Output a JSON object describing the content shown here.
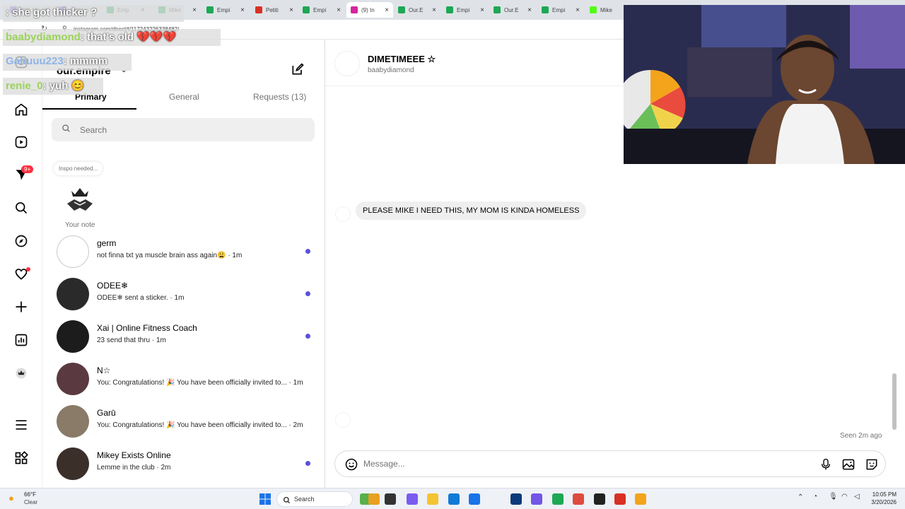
{
  "browser": {
    "tabs": [
      {
        "label": "(20) M",
        "color": "#7b5cd6"
      },
      {
        "label": "(20) L",
        "color": "#7b5cd6"
      },
      {
        "label": "Emp",
        "color": "#1ea853"
      },
      {
        "label": "Mike",
        "color": "#1ea853"
      },
      {
        "label": "Empi",
        "color": "#1ea853"
      },
      {
        "label": "Petiti",
        "color": "#d93025"
      },
      {
        "label": "Empi",
        "color": "#1ea853"
      },
      {
        "label": "(9) In",
        "color": "#d6249f"
      },
      {
        "label": "Our.E",
        "color": "#1ea853"
      },
      {
        "label": "Empi",
        "color": "#1ea853"
      },
      {
        "label": "Our.E",
        "color": "#1ea853"
      },
      {
        "label": "Empi",
        "color": "#1ea853"
      },
      {
        "label": "Mike",
        "color": "#53fc18"
      }
    ],
    "url": "instagram.com/direct/t/117243226338482/"
  },
  "overlay": {
    "lines": [
      {
        "user": "",
        "text": ": she got thicker ?"
      },
      {
        "user": "baabydiamond",
        "text": ":  that's old 💔💔💔"
      },
      {
        "user": "Gahuuu223",
        "text": ":  mmmm"
      },
      {
        "user": "renie_0",
        "text": ":  yuh 😊"
      }
    ]
  },
  "inbox": {
    "account": "our.empire",
    "tabs": [
      "Primary",
      "General",
      "Requests (13)"
    ],
    "search_placeholder": "Search",
    "note_bubble": "Inspo needed...",
    "your_note": "Your note",
    "nav_badge": "9+",
    "threads": [
      {
        "name": "germ",
        "preview": "not finna txt ya muscle brain ass again😩 · 1m",
        "unread": true,
        "avatar": "#ffffff"
      },
      {
        "name": "ODEE❄",
        "preview": "ODEE❄ sent a sticker. · 1m",
        "unread": true,
        "avatar": "#2a2a2a"
      },
      {
        "name": "Xai | Online Fitness Coach",
        "preview": "23 send that thru · 1m",
        "unread": true,
        "avatar": "#1c1c1c"
      },
      {
        "name": "N☆",
        "preview": "You: Congratulations! 🎉 You have been officially invited to... · 1m",
        "unread": false,
        "avatar": "#5a3a40"
      },
      {
        "name": "Garū",
        "preview": "You: Congratulations! 🎉 You have been officially invited to... · 2m",
        "unread": false,
        "avatar": "#8a7a68"
      },
      {
        "name": "Mikey Exists Online",
        "preview": "Lemme in the club · 2m",
        "unread": true,
        "avatar": "#3b2f2a"
      }
    ]
  },
  "chat": {
    "name": "DIMETIMEEE ☆",
    "username": "baabydiamond",
    "message": "PLEASE MIKE I NEED THIS, MY MOM IS KINDA HOMELESS",
    "seen": "Seen 2m ago",
    "placeholder": "Message..."
  },
  "taskbar": {
    "temp": "66°F",
    "weather": "Clear",
    "search": "Search",
    "time": "10:05 PM",
    "date": "3/20/2026"
  }
}
